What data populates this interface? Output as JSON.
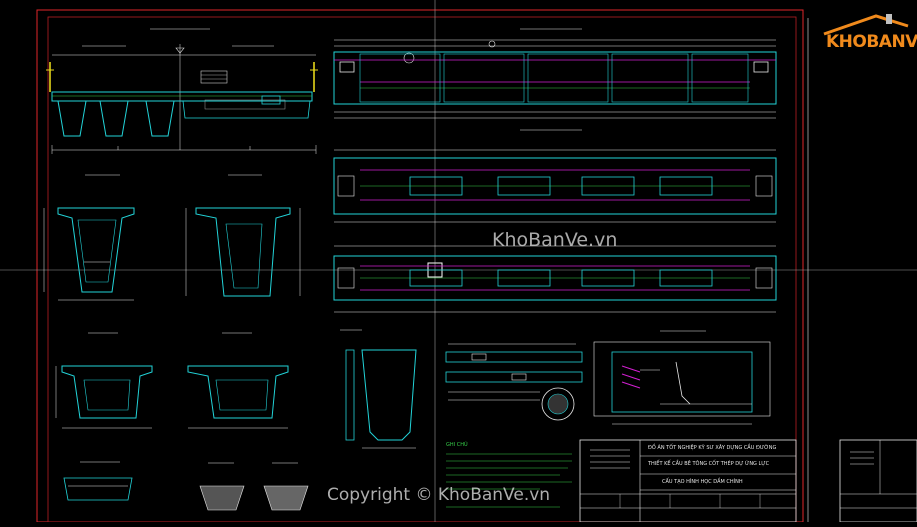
{
  "watermarks": {
    "logo_text": "KHOBANVE",
    "center": "KhoBanVe.vn",
    "copyright": "Copyright © KhoBanVe.vn"
  },
  "notes": {
    "heading": "GHI CHÚ"
  },
  "title_block": {
    "line1": "ĐỒ ÁN TỐT NGHIỆP KỸ SƯ XÂY DỰNG CẦU ĐƯỜNG",
    "line2": "THIẾT KẾ CẦU BÊ TÔNG CỐT THÉP DỰ ỨNG LỰC",
    "line3": "CẤU TẠO HÌNH HỌC DẦM CHÍNH"
  },
  "colors": {
    "border": "#e0262a",
    "section": "#22d3d8",
    "rebar": "#d21fd1",
    "line": "#e8e8e8",
    "green": "#36d04a",
    "yellow": "#e5d61a",
    "accent": "#f08a1c"
  }
}
